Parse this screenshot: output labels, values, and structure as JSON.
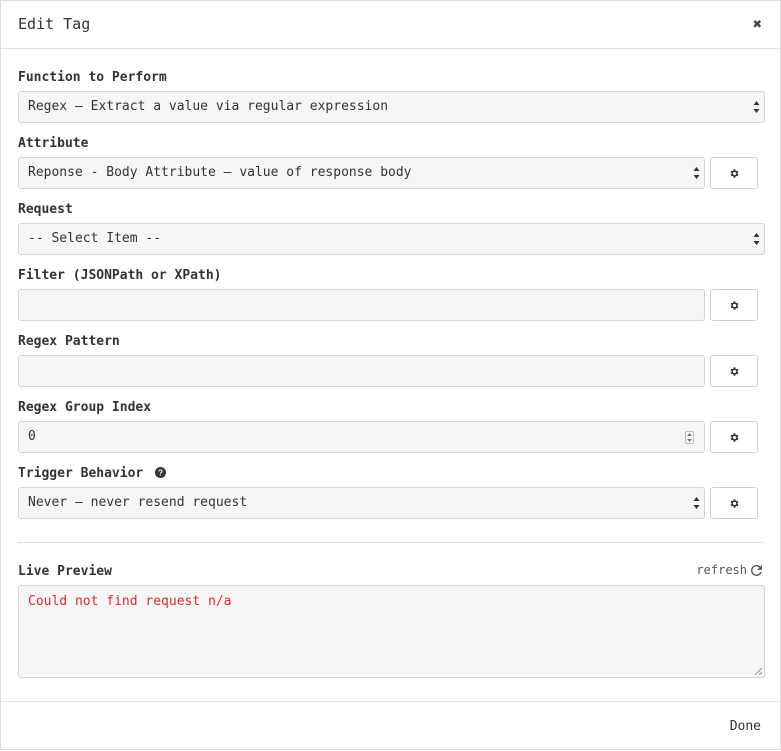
{
  "header": {
    "title": "Edit Tag",
    "close_icon": "close-icon"
  },
  "function_field": {
    "label": "Function to Perform",
    "value": "Regex – Extract a value via regular expression"
  },
  "attribute_field": {
    "label": "Attribute",
    "value": "Reponse - Body Attribute – value of response body"
  },
  "request_field": {
    "label": "Request",
    "value": "-- Select Item --"
  },
  "filter_field": {
    "label": "Filter (JSONPath or XPath)",
    "value": ""
  },
  "regex_pattern_field": {
    "label": "Regex Pattern",
    "value": ""
  },
  "regex_group_field": {
    "label": "Regex Group Index",
    "value": "0"
  },
  "trigger_field": {
    "label": "Trigger Behavior",
    "value": "Never – never resend request",
    "help_icon": "question-circle-icon"
  },
  "live_preview": {
    "label": "Live Preview",
    "refresh_label": "refresh",
    "refresh_icon": "refresh-icon",
    "text": "Could not find request n/a",
    "error_color": "#d32f2f"
  },
  "footer": {
    "done_label": "Done"
  }
}
